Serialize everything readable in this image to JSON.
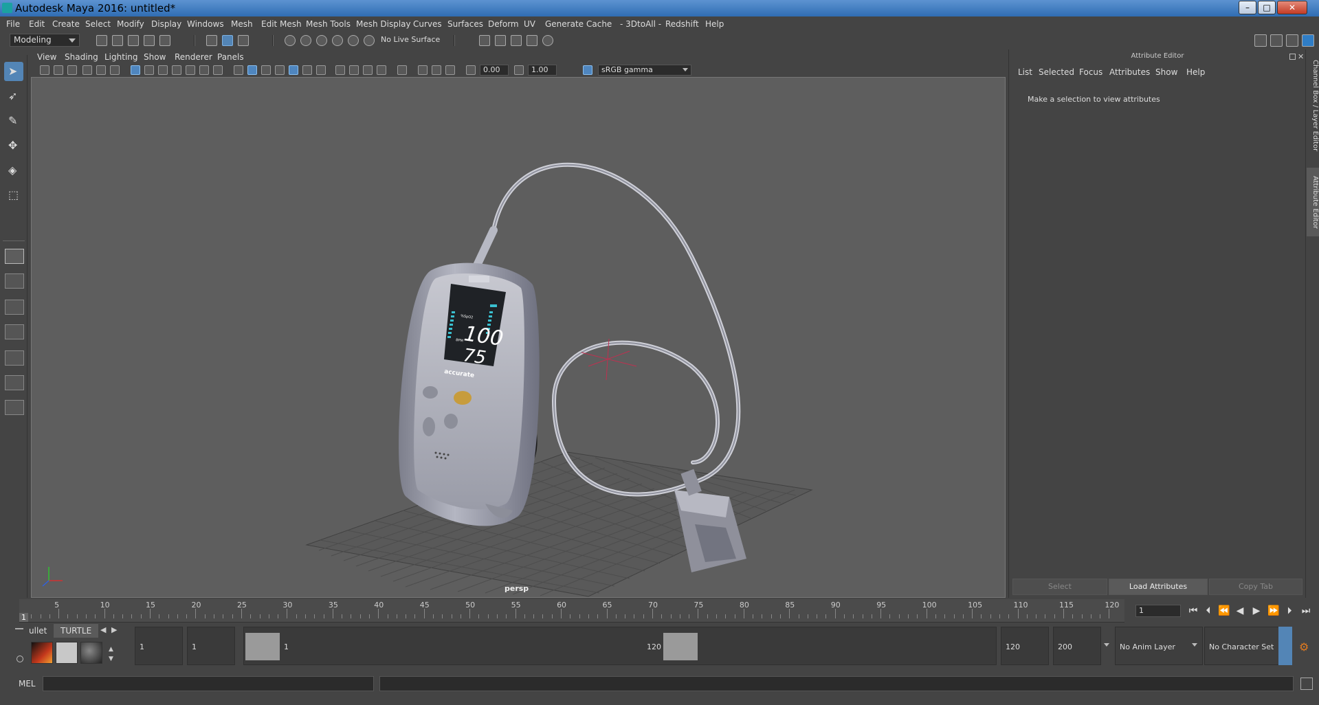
{
  "window": {
    "title": "Autodesk Maya 2016: untitled*"
  },
  "menu": [
    "File",
    "Edit",
    "Create",
    "Select",
    "Modify",
    "Display",
    "Windows",
    "Mesh",
    "Edit Mesh",
    "Mesh Tools",
    "Mesh Display",
    "Curves",
    "Surfaces",
    "Deform",
    "UV",
    "Generate",
    "Cache",
    "- 3DtoAll -",
    "Redshift",
    "Help"
  ],
  "toolbar": {
    "mode": "Modeling",
    "live_surface": "No Live Surface"
  },
  "panel": {
    "menu": [
      "View",
      "Shading",
      "Lighting",
      "Show",
      "Renderer",
      "Panels"
    ],
    "exposure": "0.00",
    "gamma": "1.00",
    "color_management": "sRGB gamma",
    "camera_label": "persp"
  },
  "attribute_editor": {
    "title": "Attribute Editor",
    "menu": [
      "List",
      "Selected",
      "Focus",
      "Attributes",
      "Show",
      "Help"
    ],
    "message": "Make a selection to view attributes",
    "buttons": {
      "select": "Select",
      "load": "Load Attributes",
      "copy": "Copy Tab"
    }
  },
  "side_tabs": {
    "channel_box": "Channel Box / Layer Editor",
    "attribute_editor": "Attribute Editor"
  },
  "device_screen": {
    "spo2": "100",
    "bpm": "75",
    "spo2_unit": "%SpO2",
    "bpm_unit": "BPM",
    "brand": "accurate"
  },
  "timeline": {
    "tick_labels": [
      "5",
      "10",
      "15",
      "20",
      "25",
      "30",
      "35",
      "40",
      "45",
      "50",
      "55",
      "60",
      "65",
      "70",
      "75",
      "80",
      "85",
      "90",
      "95",
      "100",
      "105",
      "110",
      "115",
      "120"
    ],
    "current_frame": "1",
    "frame_field": "1"
  },
  "range": {
    "start_time": "1",
    "playback_start": "1",
    "range_start_label": "1",
    "range_end_label": "120",
    "playback_end": "120",
    "end_time": "200",
    "anim_layer": "No Anim Layer",
    "character_set": "No Character Set"
  },
  "shelf_tabs": {
    "bullet": "ullet",
    "turtle": "TURTLE"
  },
  "command_line": {
    "label": "MEL"
  },
  "colors": {
    "accent": "#5385b6",
    "viewport_bg": "#5e5e5e",
    "maya_teal": "#2ab5b5"
  }
}
